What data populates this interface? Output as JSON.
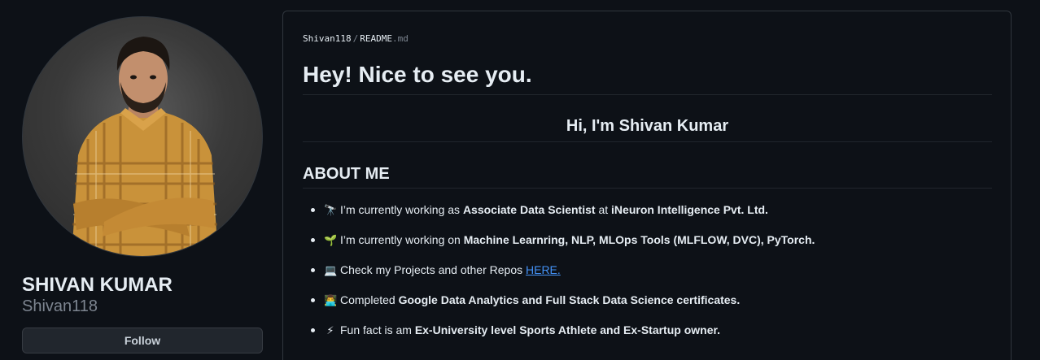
{
  "profile": {
    "name": "SHIVAN KUMAR",
    "login": "Shivan118",
    "follow_label": "Follow"
  },
  "readme": {
    "crumb_owner": "Shivan118",
    "crumb_sep": "/",
    "crumb_file": "README",
    "crumb_ext": ".md",
    "title": "Hey! Nice to see you.",
    "greeting": "Hi, I'm Shivan Kumar",
    "about_heading": "ABOUT ME",
    "items": [
      {
        "emoji": "🔭",
        "t1": "I’m currently working as ",
        "b1": "Associate Data Scientist",
        "t2": " at ",
        "b2": "iNeuron Intelligence Pvt. Ltd."
      },
      {
        "emoji": "🌱",
        "t1": "I’m currently working on ",
        "b1": "Machine Learnring, NLP, MLOps Tools (MLFLOW, DVC), PyTorch."
      },
      {
        "emoji": "💻",
        "t1": "Check my Projects and other Repos ",
        "link": "HERE."
      },
      {
        "emoji": "👨‍💻",
        "t1": "Completed ",
        "b1": "Google Data Analytics and Full Stack Data Science certificates."
      },
      {
        "emoji": "⚡",
        "t1": "Fun fact is am ",
        "b1": "Ex-University level Sports Athlete and Ex-Startup owner."
      }
    ]
  },
  "colors": {
    "background": "#0d1117",
    "border": "#30363d",
    "text": "#e6edf3",
    "muted": "#7d8590",
    "link": "#4493f8"
  }
}
